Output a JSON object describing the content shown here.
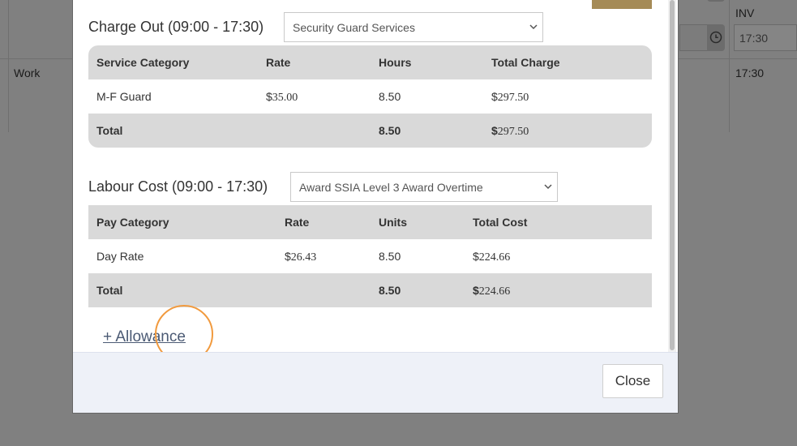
{
  "background": {
    "row_label": "Work",
    "col_header": "INV",
    "time_input_value": "17:30",
    "time_text": "17:30"
  },
  "modal": {
    "charge_out": {
      "title": "Charge Out (09:00 - 17:30)",
      "service_select": "Security Guard Services",
      "headers": [
        "Service Category",
        "Rate",
        "Hours",
        "Total Charge"
      ],
      "rows": [
        {
          "category": "M-F Guard",
          "rate_symbol": "$",
          "rate": "35.00",
          "hours": "8.50",
          "total_symbol": "$",
          "total": "297.50"
        }
      ],
      "total": {
        "label": "Total",
        "hours": "8.50",
        "total_symbol": "$",
        "total": "297.50"
      }
    },
    "labour_cost": {
      "title": "Labour Cost (09:00 - 17:30)",
      "award_select": "Award SSIA Level 3 Award Overtime",
      "headers": [
        "Pay Category",
        "Rate",
        "Units",
        "Total Cost"
      ],
      "rows": [
        {
          "category": "Day Rate",
          "rate_symbol": "$",
          "rate": "26.43",
          "units": "8.50",
          "total_symbol": "$",
          "total": "224.66"
        }
      ],
      "total": {
        "label": "Total",
        "units": "8.50",
        "total_symbol": "$",
        "total": "224.66"
      }
    },
    "allowance_link": "+ Allowance",
    "close_button": "Close"
  },
  "colors": {
    "overlay": "#808080",
    "table_header": "#d9d9d9",
    "footer": "#eef1f8",
    "link": "#4b5a74",
    "click_indicator": "#f19a3e",
    "gold_tab": "#a58b57"
  },
  "icons": [
    "clock-icon",
    "chevron-down-icon"
  ]
}
